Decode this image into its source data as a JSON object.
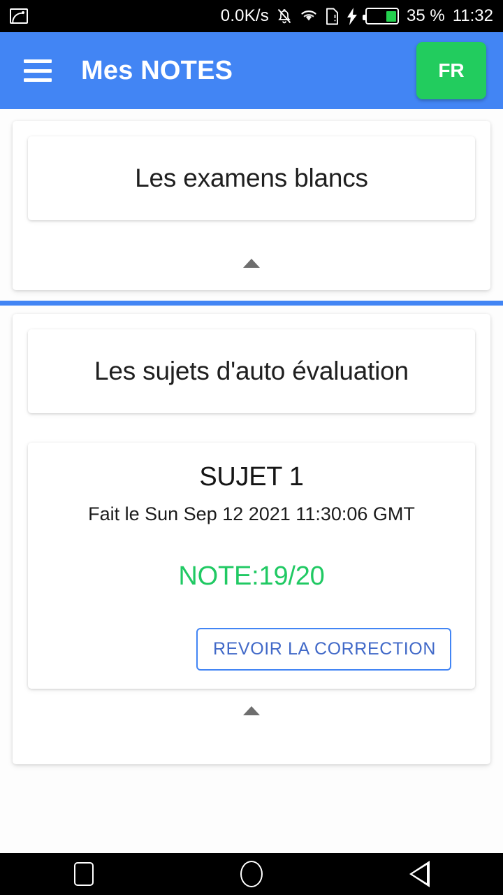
{
  "status_bar": {
    "screenshot_icon": "image-icon",
    "network_speed": "0.0K/s",
    "mute_icon": "bell-mute-icon",
    "wifi_icon": "wifi-icon",
    "sim_icon": "sim-card-icon",
    "charging_icon": "lightning-bolt-icon",
    "battery_icon": "battery-icon",
    "battery_level": "35 %",
    "battery_percent_value": 35,
    "time": "11:32"
  },
  "app_bar": {
    "menu_icon": "hamburger-menu-icon",
    "title": "Mes NOTES",
    "language_button": "FR",
    "background_color": "#4285f4",
    "language_button_color": "#22cc5e"
  },
  "sections": [
    {
      "id": "exams",
      "header": "Les examens blancs",
      "collapse_icon": "triangle-up-icon",
      "items": []
    },
    {
      "id": "autoeval",
      "header": "Les sujets d'auto évaluation",
      "collapse_icon": "triangle-up-icon",
      "items": [
        {
          "title": "SUJET 1",
          "date": "Fait le Sun Sep 12 2021 11:30:06 GMT",
          "note": "NOTE:19/20",
          "note_color": "#20c963",
          "action_label": "REVOIR LA CORRECTION"
        }
      ]
    }
  ],
  "divider": {
    "color": "#4285f4"
  },
  "nav_bar": {
    "recents_icon": "square-recents-icon",
    "home_icon": "circle-home-icon",
    "back_icon": "triangle-back-icon"
  }
}
